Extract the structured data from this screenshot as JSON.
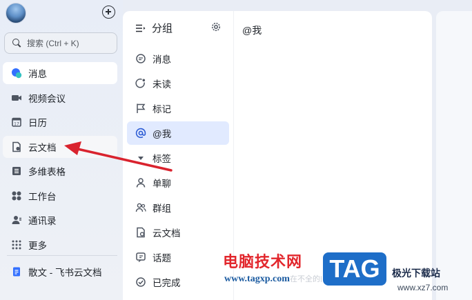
{
  "sidebar": {
    "search_placeholder": "搜索 (Ctrl + K)",
    "items": [
      {
        "label": "消息",
        "icon": "message-icon"
      },
      {
        "label": "视频会议",
        "icon": "video-icon"
      },
      {
        "label": "日历",
        "icon": "calendar-icon"
      },
      {
        "label": "云文档",
        "icon": "cloud-doc-icon"
      },
      {
        "label": "多维表格",
        "icon": "bitable-icon"
      },
      {
        "label": "工作台",
        "icon": "workspace-icon"
      },
      {
        "label": "通讯录",
        "icon": "contacts-icon"
      },
      {
        "label": "更多",
        "icon": "more-icon"
      }
    ],
    "doc_link": "散文 - 飞书云文档"
  },
  "groups": {
    "title": "分组",
    "items": [
      {
        "label": "消息",
        "icon": "chat-bubble-icon"
      },
      {
        "label": "未读",
        "icon": "unread-icon"
      },
      {
        "label": "标记",
        "icon": "flag-icon"
      },
      {
        "label": "@我",
        "icon": "at-icon"
      },
      {
        "label": "标签",
        "icon": "caret-down-icon"
      },
      {
        "label": "单聊",
        "icon": "person-icon"
      },
      {
        "label": "群组",
        "icon": "group-icon"
      },
      {
        "label": "云文档",
        "icon": "doc-icon"
      },
      {
        "label": "话题",
        "icon": "topic-icon"
      },
      {
        "label": "已完成",
        "icon": "check-circle-icon"
      }
    ]
  },
  "main": {
    "title": "@我",
    "faint_text": "在不全的的会话更要地看"
  },
  "watermark": {
    "cn_text": "电脑技术网",
    "url_text": "www.tagxp.com",
    "badge": "TAG",
    "site_cn": "极光下载站",
    "site_url": "www.xz7.com"
  },
  "colors": {
    "accent": "#3370ff",
    "active_group_bg": "#e1eaff",
    "arrow": "#d9232e"
  }
}
